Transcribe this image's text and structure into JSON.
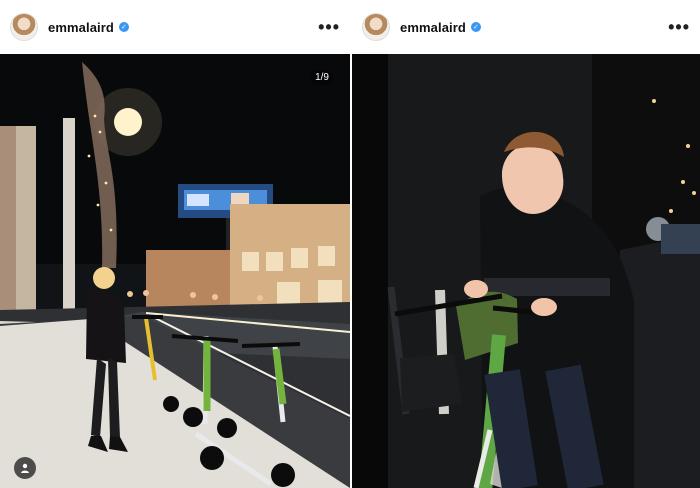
{
  "posts": [
    {
      "username": "emmalaird",
      "verified": true,
      "more_label": "•••",
      "counter": "1/9",
      "icons": [
        "avatar",
        "verified-badge-icon",
        "more-options-icon",
        "tag-user-icon"
      ]
    },
    {
      "username": "emmalaird",
      "verified": true,
      "more_label": "•••",
      "icons": [
        "avatar",
        "verified-badge-icon",
        "more-options-icon"
      ]
    }
  ],
  "colors": {
    "verified_blue": "#3897f0",
    "scooter_green": "#74b83e",
    "night_sky": "#111417"
  }
}
